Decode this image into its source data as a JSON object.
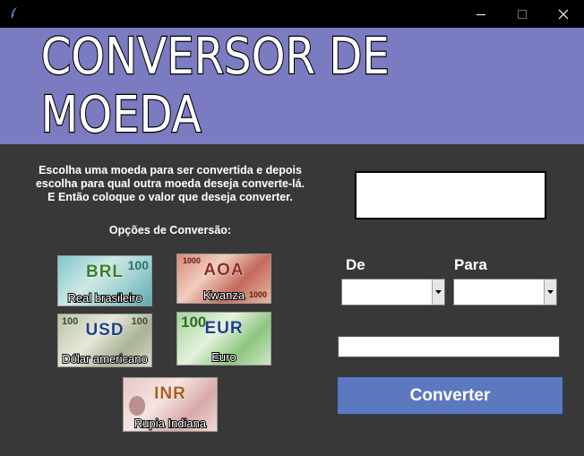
{
  "window": {
    "controls": {
      "minimize": "minimize-icon",
      "maximize": "maximize-icon",
      "close": "close-icon"
    }
  },
  "header": {
    "title": "CONVERSOR DE MOEDA",
    "bg_color": "#7b7bc1"
  },
  "instructions": {
    "lines": [
      "Escolha uma moeda para ser convertida e depois",
      "escolha para qual outra moeda deseja converte-lá.",
      "E Então coloque o valor que deseja converter."
    ]
  },
  "options": {
    "title": "Opções de Conversão:",
    "currencies": [
      {
        "code": "BRL",
        "name": "Real brasileiro"
      },
      {
        "code": "AOA",
        "name": "Kwanza"
      },
      {
        "code": "USD",
        "name": "Dólar americano"
      },
      {
        "code": "EUR",
        "name": "Euro"
      },
      {
        "code": "INR",
        "name": "Rupia Indiana"
      }
    ]
  },
  "converter": {
    "result_value": "",
    "from_label": "De",
    "to_label": "Para",
    "from_value": "",
    "to_value": "",
    "amount_value": "",
    "convert_button": "Converter",
    "button_color": "#5b78c0"
  }
}
